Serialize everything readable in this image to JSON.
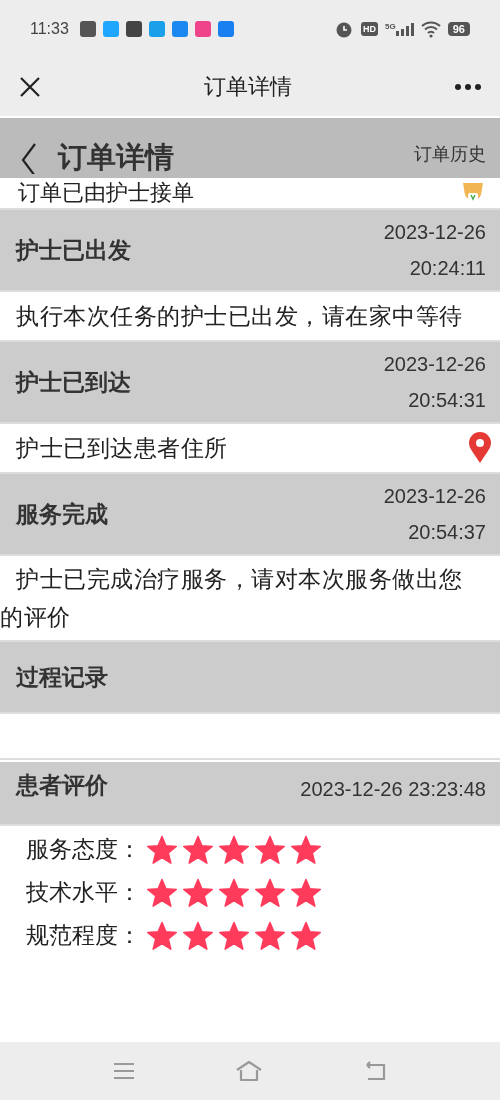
{
  "status_bar": {
    "time": "11:33",
    "hd": "HD",
    "network": "5G",
    "battery": "96"
  },
  "app_bar": {
    "title": "订单详情"
  },
  "page_header": {
    "title": "订单详情",
    "link": "订单历史"
  },
  "partial_row": {
    "text": "订单已由护士接单"
  },
  "events": [
    {
      "title": "护士已出发",
      "date": "2023-12-26",
      "time": "20:24:11",
      "text": "执行本次任务的护士已出发，请在家中等待",
      "kind": "plain"
    },
    {
      "title": "护士已到达",
      "date": "2023-12-26",
      "time": "20:54:31",
      "text": "护士已到达患者住所",
      "kind": "pin"
    },
    {
      "title": "服务完成",
      "date": "2023-12-26",
      "time": "20:54:37",
      "text": "护士已完成治疗服务，请对本次服务做出您的评价",
      "kind": "plain"
    }
  ],
  "process": {
    "title": "过程记录"
  },
  "review": {
    "title": "患者评价",
    "time": "2023-12-26 23:23:48",
    "ratings": [
      {
        "label": "服务态度：",
        "stars": 5
      },
      {
        "label": "技术水平：",
        "stars": 5
      },
      {
        "label": "规范程度：",
        "stars": 5
      }
    ]
  }
}
